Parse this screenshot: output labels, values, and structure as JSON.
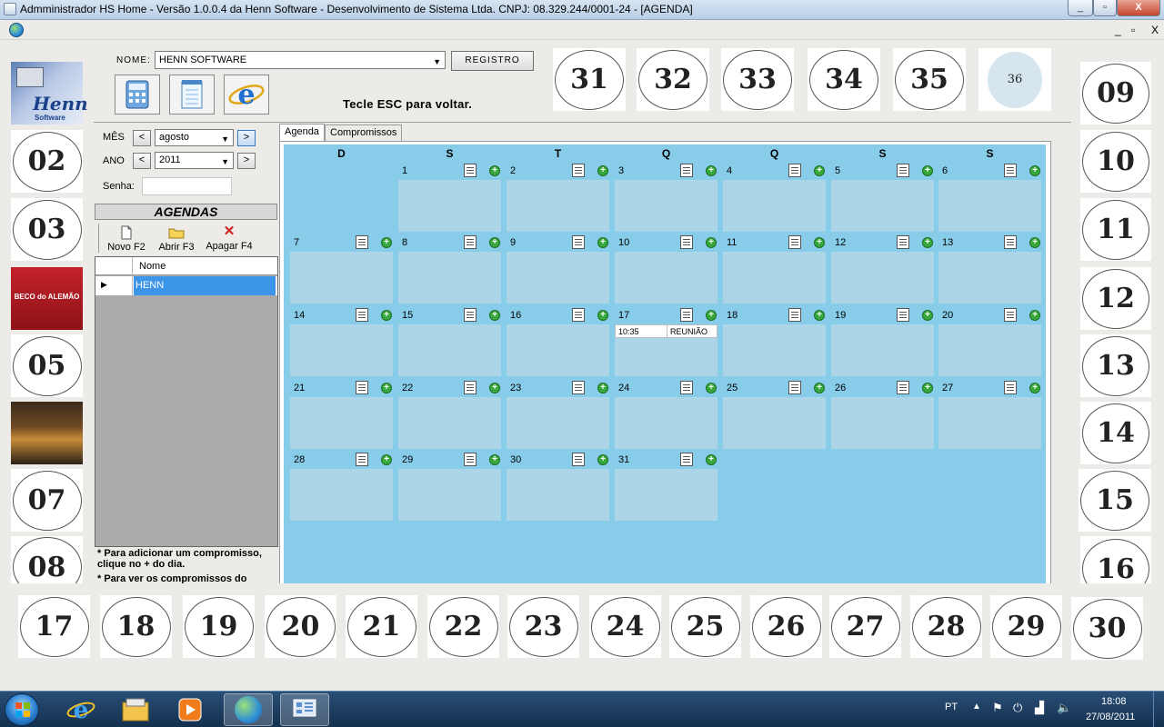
{
  "window": {
    "title": "Admministrador HS Home - Versão 1.0.0.4 da Henn Software - Desenvolvimento de Sistema Ltda. CNPJ: 08.329.244/0001-24 - [AGENDA]",
    "minimize": "_",
    "maximize": "▫",
    "close": "X",
    "mdi_minimize": "_",
    "mdi_restore": "▫",
    "mdi_close": "X"
  },
  "header": {
    "nome_label": "NOME:",
    "nome_value": "HENN SOFTWARE",
    "registro_button": "REGISTRO",
    "esc_hint": "Tecle ESC para voltar."
  },
  "tiles": {
    "top": [
      "31",
      "32",
      "33",
      "34",
      "35",
      "36"
    ],
    "left": [
      "02",
      "03",
      "05",
      "07",
      "08"
    ],
    "right": [
      "09",
      "10",
      "11",
      "12",
      "13",
      "14",
      "15",
      "16"
    ],
    "bottom": [
      "17",
      "18",
      "19",
      "20",
      "21",
      "22",
      "23",
      "24",
      "25",
      "26",
      "27",
      "28",
      "29",
      "30"
    ],
    "logo_henn_text": "Henn",
    "logo_henn_sub": "Software",
    "logo_beco_text": "BECO do ALEMÃO"
  },
  "filters": {
    "mes_label": "MÊS",
    "mes_value": "agosto",
    "ano_label": "ANO",
    "ano_value": "2011",
    "prev": "<",
    "next": ">",
    "senha_label": "Senha:",
    "senha_value": ""
  },
  "agendas": {
    "header": "AGENDAS",
    "novo": "Novo F2",
    "abrir": "Abrir F3",
    "apagar": "Apagar F4",
    "column_nome": "Nome",
    "rows": [
      "HENN"
    ]
  },
  "help": {
    "line1": "* Para adicionar um compromisso,",
    "line2": "clique no + do dia.",
    "line3": "* Para ver os compromissos do"
  },
  "tabs": [
    "Agenda",
    "Compromissos"
  ],
  "calendar": {
    "weekdays": [
      "D",
      "S",
      "T",
      "Q",
      "Q",
      "S",
      "S"
    ],
    "days": [
      "1",
      "2",
      "3",
      "4",
      "5",
      "6",
      "7",
      "8",
      "9",
      "10",
      "11",
      "12",
      "13",
      "14",
      "15",
      "16",
      "17",
      "18",
      "19",
      "20",
      "21",
      "22",
      "23",
      "24",
      "25",
      "26",
      "27",
      "28",
      "29",
      "30",
      "31"
    ],
    "first_weekday": 1,
    "plus": "+",
    "entry": {
      "day": "17",
      "time": "10:35",
      "title": "REUNIÃO"
    }
  },
  "taskbar": {
    "lang": "PT",
    "time": "18:08",
    "date": "27/08/2011"
  },
  "colors": {
    "calendar_bg": "#87cdea",
    "cell_bg": "#acd6e8",
    "selected_row": "#3c95e8"
  }
}
